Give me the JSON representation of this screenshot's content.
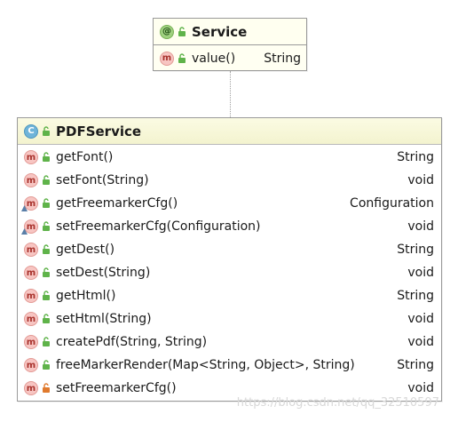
{
  "service": {
    "icon": "annotation-icon",
    "icon_letter": "@",
    "name": "Service",
    "members": [
      {
        "icon_letter": "m",
        "access": "public",
        "name": "value()",
        "type": "String"
      }
    ]
  },
  "pdf_service": {
    "icon": "class-icon",
    "icon_letter": "C",
    "name": "PDFService",
    "members": [
      {
        "icon_letter": "m",
        "access": "public",
        "override": false,
        "name": "getFont()",
        "type": "String"
      },
      {
        "icon_letter": "m",
        "access": "public",
        "override": false,
        "name": "setFont(String)",
        "type": "void"
      },
      {
        "icon_letter": "m",
        "access": "public",
        "override": true,
        "name": "getFreemarkerCfg()",
        "type": "Configuration"
      },
      {
        "icon_letter": "m",
        "access": "public",
        "override": true,
        "name": "setFreemarkerCfg(Configuration)",
        "type": "void"
      },
      {
        "icon_letter": "m",
        "access": "public",
        "override": false,
        "name": "getDest()",
        "type": "String"
      },
      {
        "icon_letter": "m",
        "access": "public",
        "override": false,
        "name": "setDest(String)",
        "type": "void"
      },
      {
        "icon_letter": "m",
        "access": "public",
        "override": false,
        "name": "getHtml()",
        "type": "String"
      },
      {
        "icon_letter": "m",
        "access": "public",
        "override": false,
        "name": "setHtml(String)",
        "type": "void"
      },
      {
        "icon_letter": "m",
        "access": "public",
        "override": false,
        "name": "createPdf(String, String)",
        "type": "void"
      },
      {
        "icon_letter": "m",
        "access": "public",
        "override": false,
        "name": "freeMarkerRender(Map<String, Object>, String)",
        "type": "String"
      },
      {
        "icon_letter": "m",
        "access": "private",
        "override": false,
        "name": "setFreemarkerCfg()",
        "type": "void"
      }
    ]
  },
  "watermark": "https://blog.csdn.net/qq_32510597",
  "colors": {
    "method_icon_bg": "#f7c5c2",
    "class_icon_bg": "#6fb4d9",
    "annotation_icon_bg": "#9fd07f",
    "public_access": "#4caf3c",
    "private_access": "#e07a2e",
    "header_bg": "#f3f3cf"
  }
}
